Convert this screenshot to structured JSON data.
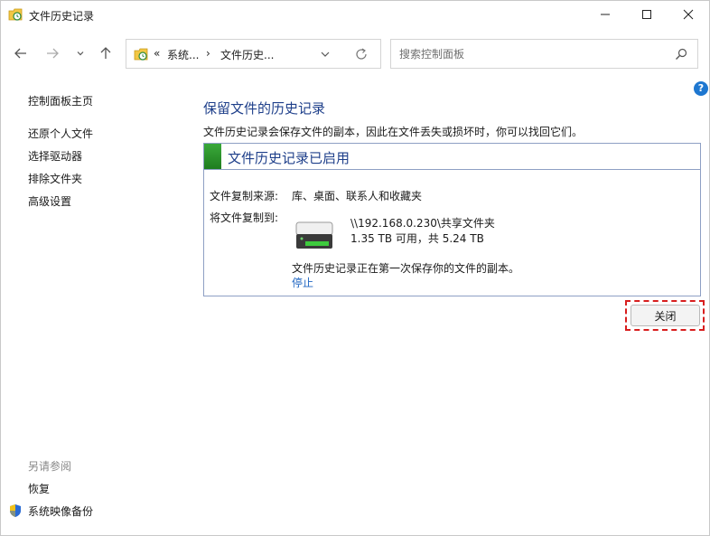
{
  "window": {
    "title": "文件历史记录"
  },
  "address": {
    "prefix": "«",
    "segments": [
      "系统...",
      "文件历史..."
    ],
    "separator": "›"
  },
  "search": {
    "placeholder": "搜索控制面板"
  },
  "sidebar": {
    "home": "控制面板主页",
    "items": [
      {
        "label": "还原个人文件"
      },
      {
        "label": "选择驱动器"
      },
      {
        "label": "排除文件夹"
      },
      {
        "label": "高级设置"
      }
    ],
    "see_also_header": "另请参阅",
    "see_also": [
      {
        "label": "恢复"
      },
      {
        "label": "系统映像备份"
      }
    ]
  },
  "main": {
    "title": "保留文件的历史记录",
    "description": "文件历史记录会保存文件的副本，因此在文件丢失或损坏时，你可以找回它们。",
    "status_title": "文件历史记录已启用",
    "source_label": "文件复制来源:",
    "source_value": "库、桌面、联系人和收藏夹",
    "dest_label": "将文件复制到:",
    "drive_path": "\\\\192.168.0.230\\共享文件夹",
    "drive_space": "1.35 TB 可用，共 5.24 TB",
    "note": "文件历史记录正在第一次保存你的文件的副本。",
    "stop_link": "停止"
  },
  "buttons": {
    "close": "关闭"
  },
  "colors": {
    "status_green": "#2d9a2d",
    "title_blue": "#1e3f8a",
    "link_blue": "#1f66c2",
    "highlight_red": "#d81e1e"
  }
}
